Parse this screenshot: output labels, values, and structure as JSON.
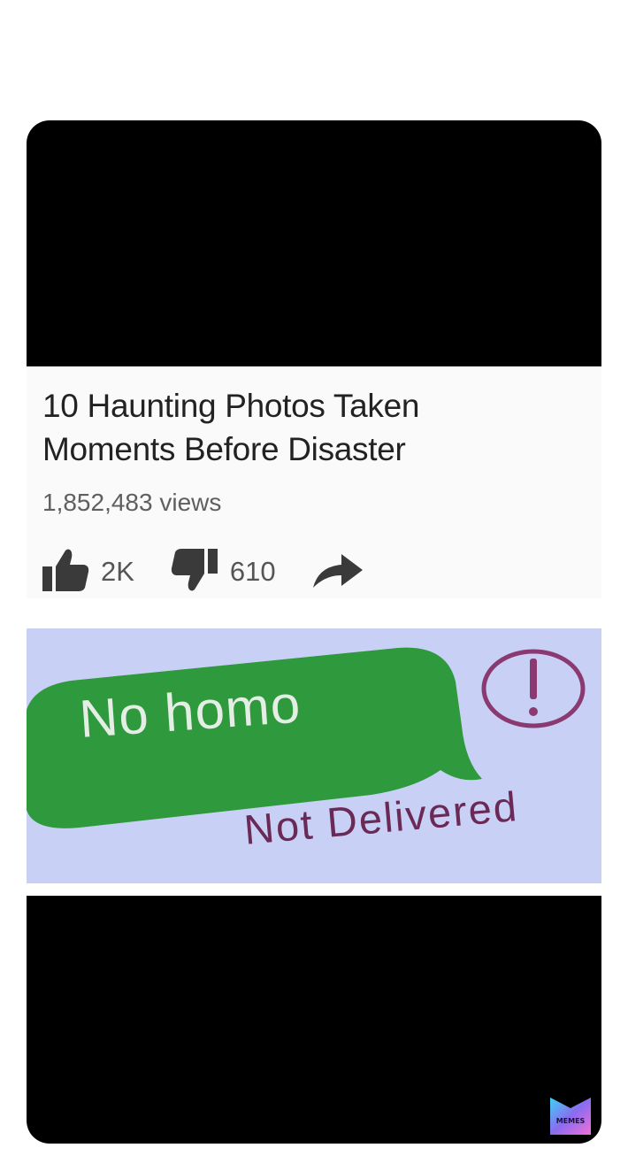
{
  "video": {
    "title_line1": "10 Haunting Photos Taken",
    "title_line2": "Moments Before Disaster",
    "views": "1,852,483 views",
    "likes": "2K",
    "dislikes": "610"
  },
  "message": {
    "text": "No homo",
    "status": "Not Delivered",
    "bubble_color": "#2f9a3d",
    "background_color": "#c9d0f6"
  },
  "watermark": {
    "label": "MEMES"
  },
  "icons": {
    "like": "thumbs-up-icon",
    "dislike": "thumbs-down-icon",
    "share": "share-arrow-icon",
    "alert": "exclamation-circle-icon"
  }
}
